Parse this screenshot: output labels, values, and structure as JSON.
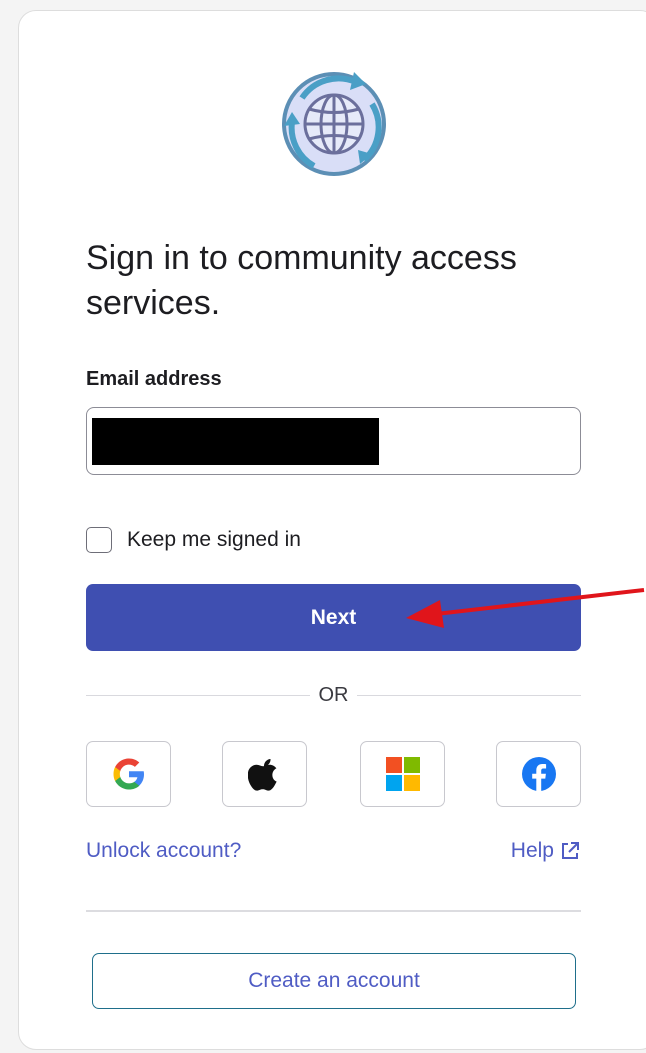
{
  "header": {
    "title": "Sign in to community access services."
  },
  "form": {
    "email_label": "Email address",
    "email_value": "",
    "keep_signed_in_label": "Keep me signed in",
    "next_label": "Next",
    "or_label": "OR"
  },
  "social": [
    {
      "provider": "google",
      "icon": "google-icon"
    },
    {
      "provider": "apple",
      "icon": "apple-icon"
    },
    {
      "provider": "microsoft",
      "icon": "microsoft-icon"
    },
    {
      "provider": "facebook",
      "icon": "facebook-icon"
    }
  ],
  "links": {
    "unlock_label": "Unlock account?",
    "help_label": "Help"
  },
  "footer": {
    "create_account_label": "Create an account"
  },
  "colors": {
    "primary": "#3f4fb1",
    "link": "#4f5cc4",
    "annotation_arrow": "#e0151b"
  }
}
